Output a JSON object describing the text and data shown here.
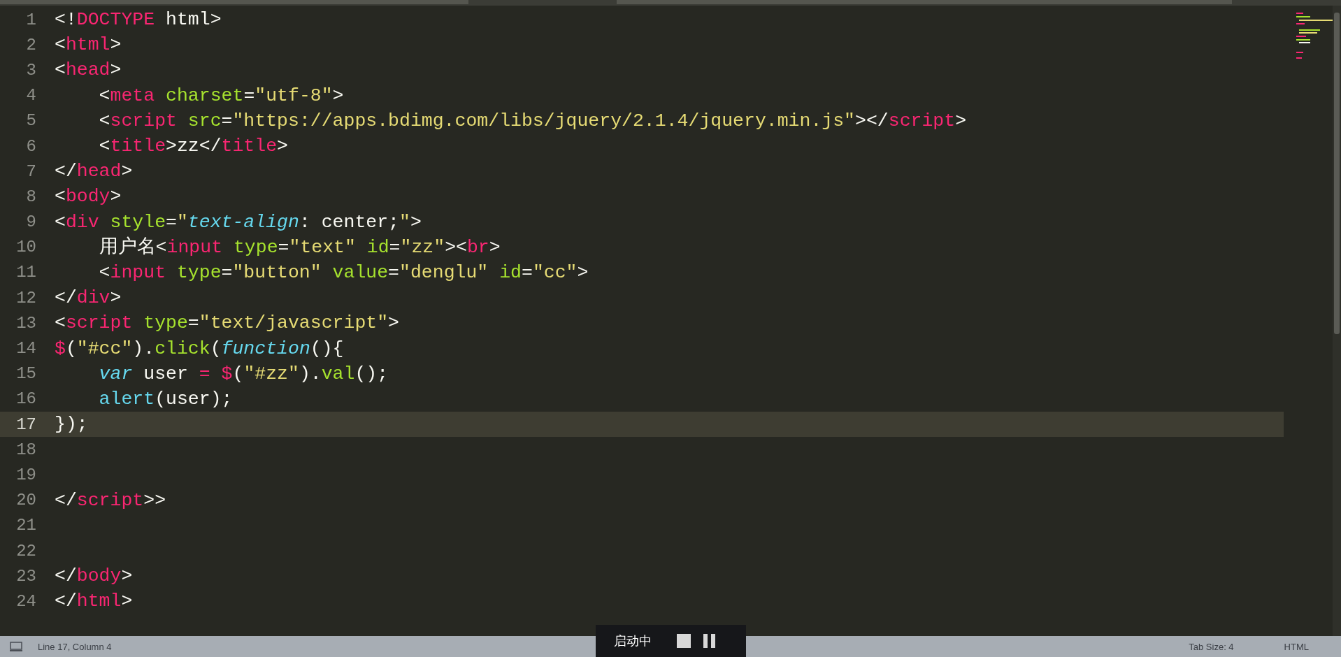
{
  "editor": {
    "lines": [
      {
        "number": "1",
        "selected": false,
        "tokens": [
          {
            "kind": "plain",
            "text": "<!"
          },
          {
            "kind": "tag",
            "text": "DOCTYPE"
          },
          {
            "kind": "plain",
            "text": " html>"
          }
        ]
      },
      {
        "number": "2",
        "selected": false,
        "tokens": [
          {
            "kind": "plain",
            "text": "<"
          },
          {
            "kind": "tag",
            "text": "html"
          },
          {
            "kind": "plain",
            "text": ">"
          }
        ]
      },
      {
        "number": "3",
        "selected": false,
        "tokens": [
          {
            "kind": "plain",
            "text": "<"
          },
          {
            "kind": "tag",
            "text": "head"
          },
          {
            "kind": "plain",
            "text": ">"
          }
        ]
      },
      {
        "number": "4",
        "selected": false,
        "tokens": [
          {
            "kind": "plain",
            "text": "    <"
          },
          {
            "kind": "tag",
            "text": "meta"
          },
          {
            "kind": "attr",
            "text": " charset"
          },
          {
            "kind": "plain",
            "text": "="
          },
          {
            "kind": "string",
            "text": "\"utf-8\""
          },
          {
            "kind": "plain",
            "text": ">"
          }
        ]
      },
      {
        "number": "5",
        "selected": false,
        "tokens": [
          {
            "kind": "plain",
            "text": "    <"
          },
          {
            "kind": "tag",
            "text": "script"
          },
          {
            "kind": "attr",
            "text": " src"
          },
          {
            "kind": "plain",
            "text": "="
          },
          {
            "kind": "string",
            "text": "\"https://apps.bdimg.com/libs/jquery/2.1.4/jquery.min.js\""
          },
          {
            "kind": "plain",
            "text": "></"
          },
          {
            "kind": "tag",
            "text": "script"
          },
          {
            "kind": "plain",
            "text": ">"
          }
        ]
      },
      {
        "number": "6",
        "selected": false,
        "tokens": [
          {
            "kind": "plain",
            "text": "    <"
          },
          {
            "kind": "tag",
            "text": "title"
          },
          {
            "kind": "plain",
            "text": ">zz</"
          },
          {
            "kind": "tag",
            "text": "title"
          },
          {
            "kind": "plain",
            "text": ">"
          }
        ]
      },
      {
        "number": "7",
        "selected": false,
        "tokens": [
          {
            "kind": "plain",
            "text": "</"
          },
          {
            "kind": "tag",
            "text": "head"
          },
          {
            "kind": "plain",
            "text": ">"
          }
        ]
      },
      {
        "number": "8",
        "selected": false,
        "tokens": [
          {
            "kind": "plain",
            "text": "<"
          },
          {
            "kind": "tag",
            "text": "body"
          },
          {
            "kind": "plain",
            "text": ">"
          }
        ]
      },
      {
        "number": "9",
        "selected": false,
        "tokens": [
          {
            "kind": "plain",
            "text": "<"
          },
          {
            "kind": "tag",
            "text": "div"
          },
          {
            "kind": "attr",
            "text": " style"
          },
          {
            "kind": "plain",
            "text": "="
          },
          {
            "kind": "string",
            "text": "\""
          },
          {
            "kind": "property",
            "text": "text-align"
          },
          {
            "kind": "plain",
            "text": ": center;"
          },
          {
            "kind": "string",
            "text": "\""
          },
          {
            "kind": "plain",
            "text": ">"
          }
        ]
      },
      {
        "number": "10",
        "selected": false,
        "tokens": [
          {
            "kind": "plain",
            "text": "    用户名<"
          },
          {
            "kind": "tag",
            "text": "input"
          },
          {
            "kind": "attr",
            "text": " type"
          },
          {
            "kind": "plain",
            "text": "="
          },
          {
            "kind": "string",
            "text": "\"text\""
          },
          {
            "kind": "attr",
            "text": " id"
          },
          {
            "kind": "plain",
            "text": "="
          },
          {
            "kind": "string",
            "text": "\"zz\""
          },
          {
            "kind": "plain",
            "text": "><"
          },
          {
            "kind": "tag",
            "text": "br"
          },
          {
            "kind": "plain",
            "text": ">"
          }
        ]
      },
      {
        "number": "11",
        "selected": false,
        "tokens": [
          {
            "kind": "plain",
            "text": "    <"
          },
          {
            "kind": "tag",
            "text": "input"
          },
          {
            "kind": "attr",
            "text": " type"
          },
          {
            "kind": "plain",
            "text": "="
          },
          {
            "kind": "string",
            "text": "\"button\""
          },
          {
            "kind": "attr",
            "text": " value"
          },
          {
            "kind": "plain",
            "text": "="
          },
          {
            "kind": "string",
            "text": "\"denglu\""
          },
          {
            "kind": "attr",
            "text": " id"
          },
          {
            "kind": "plain",
            "text": "="
          },
          {
            "kind": "string",
            "text": "\"cc\""
          },
          {
            "kind": "plain",
            "text": ">"
          }
        ]
      },
      {
        "number": "12",
        "selected": false,
        "tokens": [
          {
            "kind": "plain",
            "text": "</"
          },
          {
            "kind": "tag",
            "text": "div"
          },
          {
            "kind": "plain",
            "text": ">"
          }
        ]
      },
      {
        "number": "13",
        "selected": false,
        "tokens": [
          {
            "kind": "plain",
            "text": "<"
          },
          {
            "kind": "tag",
            "text": "script"
          },
          {
            "kind": "attr",
            "text": " type"
          },
          {
            "kind": "plain",
            "text": "="
          },
          {
            "kind": "string",
            "text": "\"text/javascript\""
          },
          {
            "kind": "plain",
            "text": ">"
          }
        ]
      },
      {
        "number": "14",
        "selected": false,
        "tokens": [
          {
            "kind": "tag",
            "text": "$"
          },
          {
            "kind": "plain",
            "text": "("
          },
          {
            "kind": "string",
            "text": "\"#cc\""
          },
          {
            "kind": "plain",
            "text": ")."
          },
          {
            "kind": "attr",
            "text": "click"
          },
          {
            "kind": "plain",
            "text": "("
          },
          {
            "kind": "keyword",
            "text": "function"
          },
          {
            "kind": "plain",
            "text": "(){"
          }
        ]
      },
      {
        "number": "15",
        "selected": false,
        "tokens": [
          {
            "kind": "keyword",
            "text": "    var"
          },
          {
            "kind": "plain",
            "text": " user "
          },
          {
            "kind": "tag",
            "text": "= $"
          },
          {
            "kind": "plain",
            "text": "("
          },
          {
            "kind": "string",
            "text": "\"#zz\""
          },
          {
            "kind": "plain",
            "text": ")."
          },
          {
            "kind": "attr",
            "text": "val"
          },
          {
            "kind": "plain",
            "text": "();"
          }
        ]
      },
      {
        "number": "16",
        "selected": false,
        "tokens": [
          {
            "kind": "support",
            "text": "    alert"
          },
          {
            "kind": "plain",
            "text": "(user);"
          }
        ]
      },
      {
        "number": "17",
        "selected": true,
        "tokens": [
          {
            "kind": "plain",
            "text": "});"
          }
        ]
      },
      {
        "number": "18",
        "selected": false
      },
      {
        "number": "19",
        "selected": false
      },
      {
        "number": "20",
        "selected": false,
        "tokens": [
          {
            "kind": "plain",
            "text": "</"
          },
          {
            "kind": "tag",
            "text": "script"
          },
          {
            "kind": "plain",
            "text": ">>"
          }
        ]
      },
      {
        "number": "21",
        "selected": false
      },
      {
        "number": "22",
        "selected": false
      },
      {
        "number": "23",
        "selected": false,
        "tokens": [
          {
            "kind": "plain",
            "text": "</"
          },
          {
            "kind": "tag",
            "text": "body"
          },
          {
            "kind": "plain",
            "text": ">"
          }
        ]
      },
      {
        "number": "24",
        "selected": false,
        "tokens": [
          {
            "kind": "plain",
            "text": "</"
          },
          {
            "kind": "tag",
            "text": "html"
          },
          {
            "kind": "plain",
            "text": ">"
          }
        ]
      }
    ]
  },
  "recorder": {
    "label": "启动中"
  },
  "status_bar": {
    "position": "Line 17, Column 4",
    "tab_size": "Tab Size: 4",
    "syntax": "HTML"
  }
}
